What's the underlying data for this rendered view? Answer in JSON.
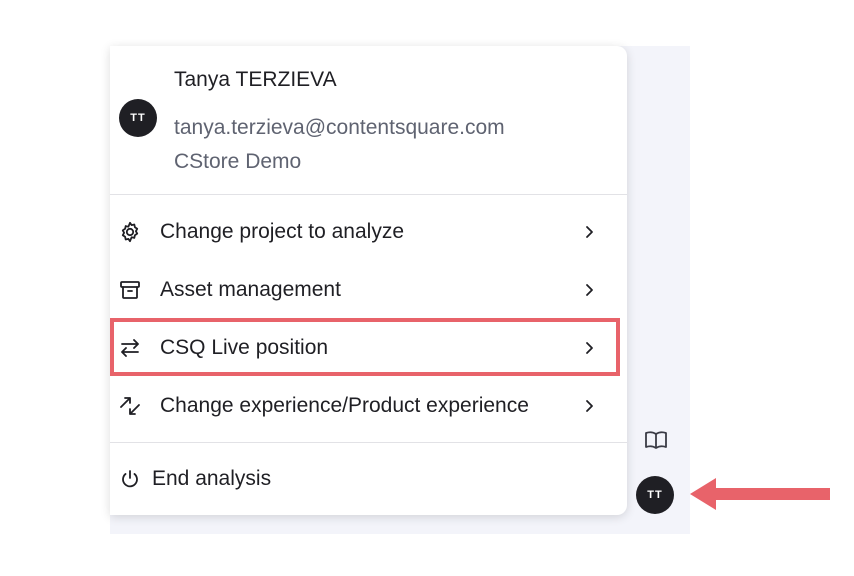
{
  "user": {
    "initials": "TT",
    "name": "Tanya TERZIEVA",
    "email": "tanya.terzieva@contentsquare.com",
    "project": "CStore Demo"
  },
  "menu": {
    "items": [
      {
        "label": "Change project to analyze",
        "icon": "gear-icon"
      },
      {
        "label": "Asset management",
        "icon": "archive-icon"
      },
      {
        "label": "CSQ Live position",
        "icon": "swap-arrows-icon"
      },
      {
        "label": "Change experience/Product experience",
        "icon": "diagonal-swap-icon"
      }
    ],
    "end_label": "End analysis",
    "end_icon": "power-icon"
  },
  "sidebar": {
    "avatar_initials": "TT",
    "book_icon": "book-open-icon"
  },
  "annotation": {
    "highlight_color": "#e8636a",
    "arrow_color": "#e8636a"
  }
}
